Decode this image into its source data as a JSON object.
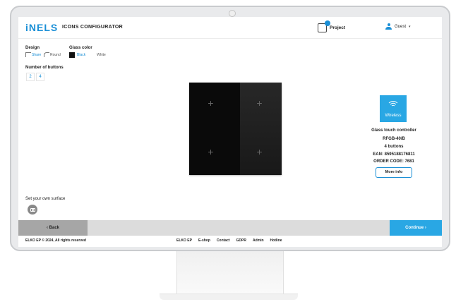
{
  "header": {
    "logo": "iNELS",
    "title": "ICONS CONFIGURATOR",
    "project_label": "Project",
    "user_label": "Guest",
    "user_caret": "▾"
  },
  "design": {
    "label": "Design",
    "options": [
      "Share",
      "Round"
    ],
    "selected": "Share"
  },
  "glass_color": {
    "label": "Glass color",
    "options": [
      "Black",
      "White"
    ],
    "selected": "Black"
  },
  "buttons": {
    "label": "Number of buttons",
    "options": [
      "2",
      "4"
    ],
    "selected": "4"
  },
  "preview": {
    "plus_glyph": "+"
  },
  "product": {
    "badge": "Wireless",
    "name": "Glass touch controller",
    "model": "RFGB-40/B",
    "buttons_count": "4 buttons",
    "ean": "EAN: 8595188176811",
    "order_code": "ORDER CODE: 7681",
    "more_info": "More info"
  },
  "surface": {
    "label": "Set your own surface"
  },
  "nav": {
    "back": "‹  Back",
    "continue": "Continue  ›"
  },
  "footer": {
    "copyright": "ELKO EP © 2024, All rights reserved",
    "links": [
      "ELKO EP",
      "E-shop",
      "Contact",
      "GDPR",
      "Admin",
      "Hotline"
    ]
  },
  "colors": {
    "accent": "#29a7e4",
    "panel": "#0a0a0a"
  }
}
